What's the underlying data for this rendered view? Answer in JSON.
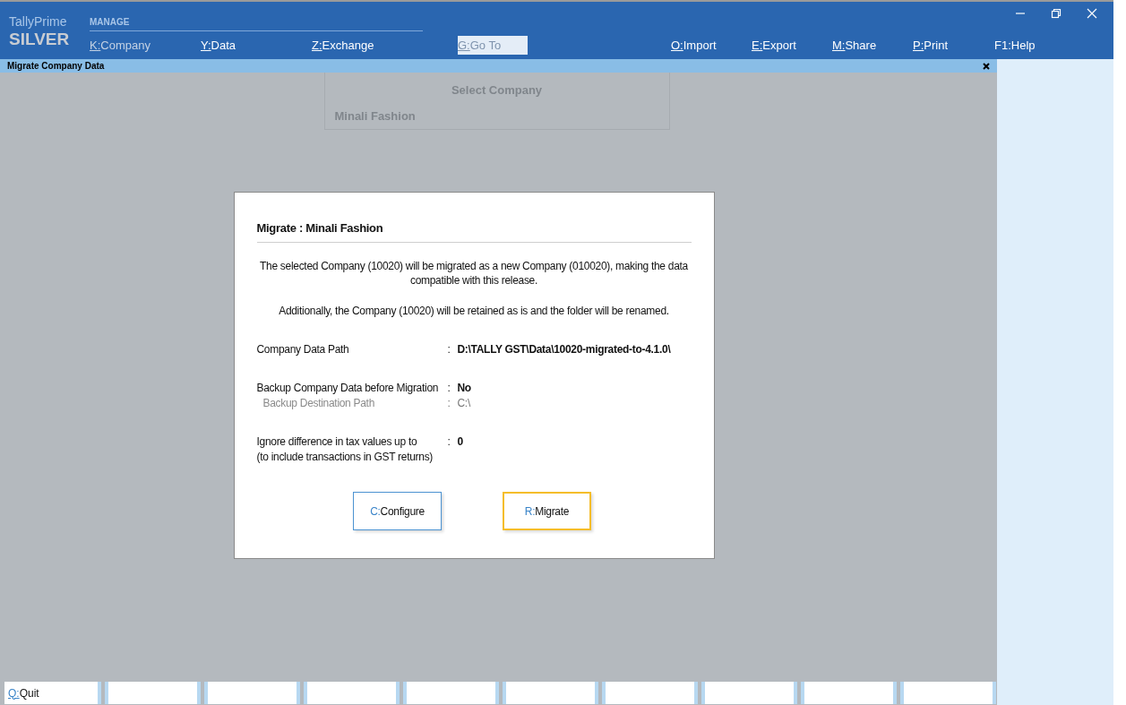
{
  "brand": {
    "product": "TallyPrime",
    "edition": "SILVER"
  },
  "menu": {
    "section": "MANAGE",
    "left_items": [
      {
        "key": "K:",
        "label": "Company",
        "dimmed": true,
        "disabled": false
      },
      {
        "key": "Y:",
        "label": "Data",
        "dimmed": false,
        "disabled": false
      },
      {
        "key": "Z:",
        "label": "Exchange",
        "dimmed": false,
        "disabled": false
      },
      {
        "key": "G:",
        "label": "Go To",
        "dimmed": false,
        "disabled": true
      }
    ],
    "right_items": [
      {
        "key": "O:",
        "label": "Import",
        "underline": true
      },
      {
        "key": "E:",
        "label": "Export",
        "underline": true
      },
      {
        "key": "M:",
        "label": "Share",
        "underline": true
      },
      {
        "key": "P:",
        "label": "Print",
        "underline": true
      },
      {
        "key": "F1:",
        "label": "Help",
        "underline": false
      }
    ]
  },
  "screen_title": "Migrate Company Data",
  "background_panel": {
    "title": "Select Company",
    "item": "Minali Fashion"
  },
  "dialog": {
    "title": "Migrate : Minali Fashion",
    "messages": [
      "The selected Company (10020) will be migrated as a new Company (010020), making the data compatible with this release.",
      "Additionally, the Company (10020) will be retained as is and the folder will be renamed."
    ],
    "field_groups": [
      [
        {
          "label": "Company Data Path",
          "colon": ":",
          "value": "D:\\TALLY GST\\Data\\10020-migrated-to-4.1.0\\",
          "dimmed": false
        }
      ],
      [
        {
          "label": "Backup Company Data before Migration",
          "colon": ":",
          "value": "No",
          "dimmed": false
        },
        {
          "label": "Backup Destination Path",
          "colon": ":",
          "value": "C:\\",
          "dimmed": true
        }
      ],
      [
        {
          "label": "Ignore difference in tax values up to",
          "note": "(to include transactions in GST returns)",
          "colon": ":",
          "value": "0",
          "dimmed": false
        }
      ]
    ],
    "buttons": [
      {
        "key": "C:",
        "label": "Configure",
        "selected": false
      },
      {
        "key": "R:",
        "label": "Migrate",
        "selected": true
      }
    ]
  },
  "bottom_bar": {
    "buttons": [
      {
        "key": "Q:",
        "label": "Quit"
      }
    ]
  }
}
